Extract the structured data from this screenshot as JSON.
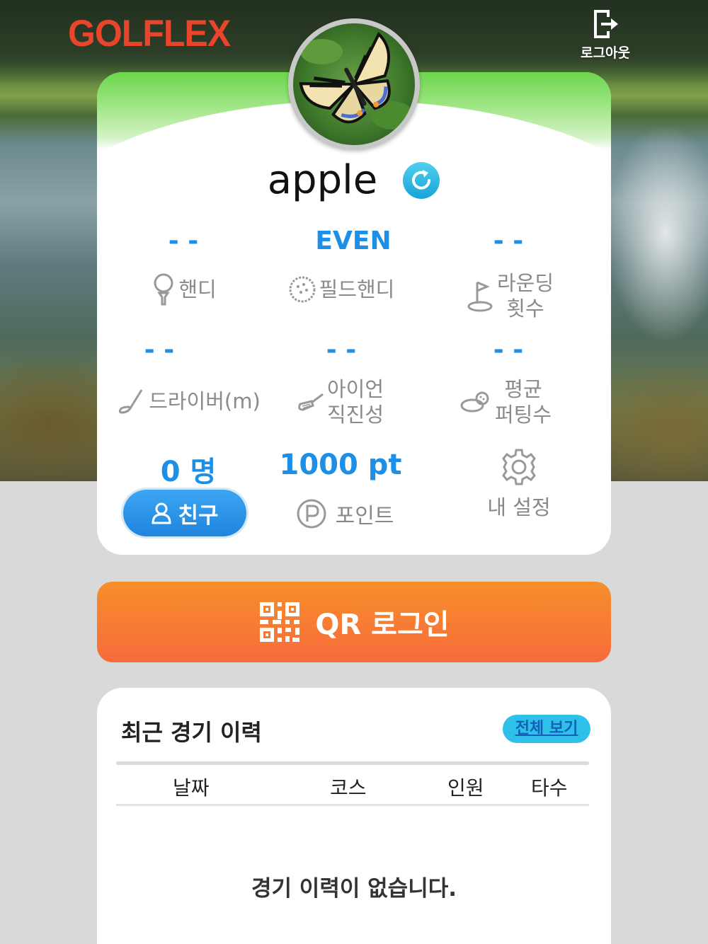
{
  "header": {
    "logo": "GOLFLEX",
    "logout_label": "로그아웃"
  },
  "profile": {
    "username": "apple"
  },
  "stats": {
    "handicap": {
      "value": "- -",
      "label": "핸디"
    },
    "field_handicap": {
      "value": "EVEN",
      "label": "필드핸디"
    },
    "rounds": {
      "value": "- -",
      "label_line1": "라운딩",
      "label_line2": "횟수"
    },
    "driver": {
      "value": "- -",
      "label": "드라이버(m)"
    },
    "iron": {
      "value": "- -",
      "label_line1": "아이언",
      "label_line2": "직진성"
    },
    "putting": {
      "value": "- -",
      "label_line1": "평균",
      "label_line2": "퍼팅수"
    }
  },
  "friends": {
    "count": "0 명",
    "button_label": "친구"
  },
  "points": {
    "value": "1000 pt",
    "label": "포인트"
  },
  "settings": {
    "label": "내 설정"
  },
  "qr_login": {
    "label": "QR 로그인"
  },
  "history": {
    "title": "최근 경기 이력",
    "view_all_label": "전체 보기",
    "columns": [
      "날짜",
      "코스",
      "인원",
      "타수"
    ],
    "empty_message": "경기 이력이 없습니다."
  },
  "colors": {
    "accent_blue": "#1e8fe6",
    "logo_red": "#e8452c",
    "qr_orange": "#f68f2a"
  }
}
